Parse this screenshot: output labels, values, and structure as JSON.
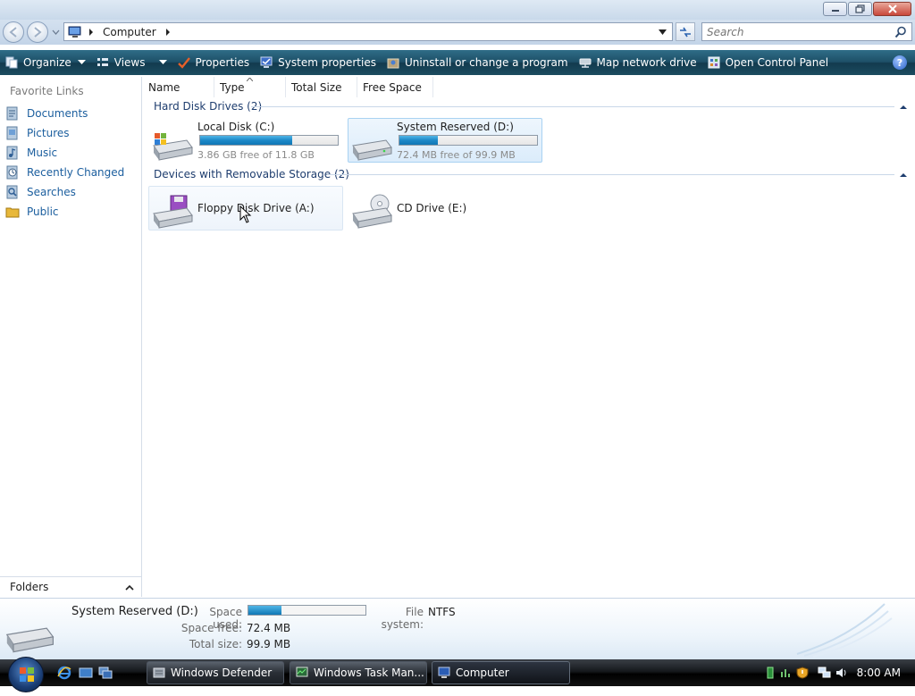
{
  "window": {
    "address": {
      "location": "Computer"
    },
    "search": {
      "placeholder": "Search"
    }
  },
  "toolbar": {
    "organize": "Organize",
    "views": "Views",
    "properties": "Properties",
    "system_properties": "System properties",
    "uninstall": "Uninstall or change a program",
    "map_drive": "Map network drive",
    "control_panel": "Open Control Panel",
    "help": "?"
  },
  "sidebar": {
    "heading": "Favorite Links",
    "items": [
      {
        "label": "Documents",
        "icon": "documents-icon"
      },
      {
        "label": "Pictures",
        "icon": "pictures-icon"
      },
      {
        "label": "Music",
        "icon": "music-icon"
      },
      {
        "label": "Recently Changed",
        "icon": "recently-changed-icon"
      },
      {
        "label": "Searches",
        "icon": "searches-icon"
      },
      {
        "label": "Public",
        "icon": "public-folder-icon"
      }
    ],
    "folders_label": "Folders"
  },
  "columns": [
    "Name",
    "Type",
    "Total Size",
    "Free Space"
  ],
  "groups": [
    {
      "title": "Hard Disk Drives (2)",
      "items": [
        {
          "name": "Local Disk (C:)",
          "free_text": "3.86 GB free of 11.8 GB",
          "used_fraction": 0.67
        },
        {
          "name": "System Reserved (D:)",
          "free_text": "72.4 MB free of 99.9 MB",
          "used_fraction": 0.28
        }
      ]
    },
    {
      "title": "Devices with Removable Storage (2)",
      "items": [
        {
          "name": "Floppy Disk Drive (A:)"
        },
        {
          "name": "CD Drive (E:)"
        }
      ]
    }
  ],
  "details": {
    "name": "System Reserved (D:)",
    "space_used_label": "Space used:",
    "space_used_fraction": 0.28,
    "file_system_label": "File system:",
    "file_system": "NTFS",
    "space_free_label": "Space free:",
    "space_free": "72.4 MB",
    "total_size_label": "Total size:",
    "total_size": "99.9 MB"
  },
  "taskbar": {
    "buttons": [
      {
        "label": "Windows Defender"
      },
      {
        "label": "Windows Task Man..."
      },
      {
        "label": "Computer"
      }
    ],
    "clock": "8:00 AM"
  },
  "colors": {
    "accent": "#1d89c8",
    "command_bar": "#1d4f67",
    "link": "#1b5e9e"
  }
}
